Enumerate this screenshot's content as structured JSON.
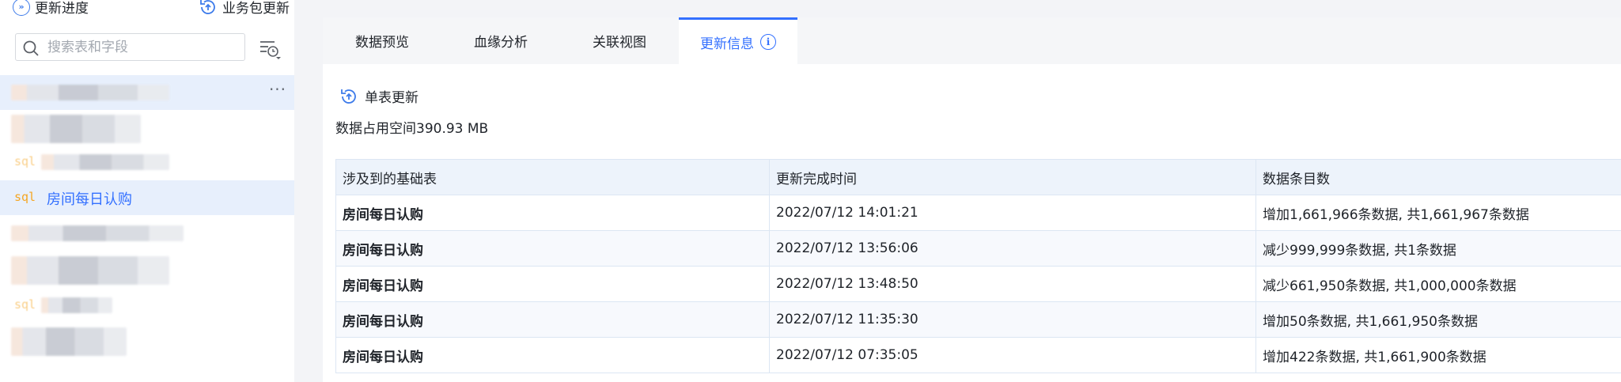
{
  "sidebar": {
    "progress_label": "更新进度",
    "package_update_label": "业务包更新",
    "search_placeholder": "搜索表和字段",
    "sql_tag": "sql",
    "selected_table": "房间每日认购",
    "more_label": "···"
  },
  "tabs": [
    {
      "label": "数据预览"
    },
    {
      "label": "血缘分析"
    },
    {
      "label": "关联视图"
    },
    {
      "label": "更新信息"
    }
  ],
  "info_icon_glyph": "i",
  "update_info": {
    "single_update_label": "单表更新",
    "space_label": "数据占用空间",
    "space_value": "390.93 MB"
  },
  "table": {
    "headers": [
      "涉及到的基础表",
      "更新完成时间",
      "数据条目数"
    ],
    "rows": [
      {
        "table": "房间每日认购",
        "time": "2022/07/12 14:01:21",
        "count": "增加1,661,966条数据, 共1,661,967条数据"
      },
      {
        "table": "房间每日认购",
        "time": "2022/07/12 13:56:06",
        "count": "减少999,999条数据, 共1条数据"
      },
      {
        "table": "房间每日认购",
        "time": "2022/07/12 13:48:50",
        "count": "减少661,950条数据, 共1,000,000条数据"
      },
      {
        "table": "房间每日认购",
        "time": "2022/07/12 11:35:30",
        "count": "增加50条数据, 共1,661,950条数据"
      },
      {
        "table": "房间每日认购",
        "time": "2022/07/12 07:35:05",
        "count": "增加422条数据, 共1,661,900条数据"
      }
    ]
  },
  "colors": {
    "accent": "#3370ff",
    "sql_orange": "#f5a623",
    "selected_row_bg": "#e7effc"
  }
}
